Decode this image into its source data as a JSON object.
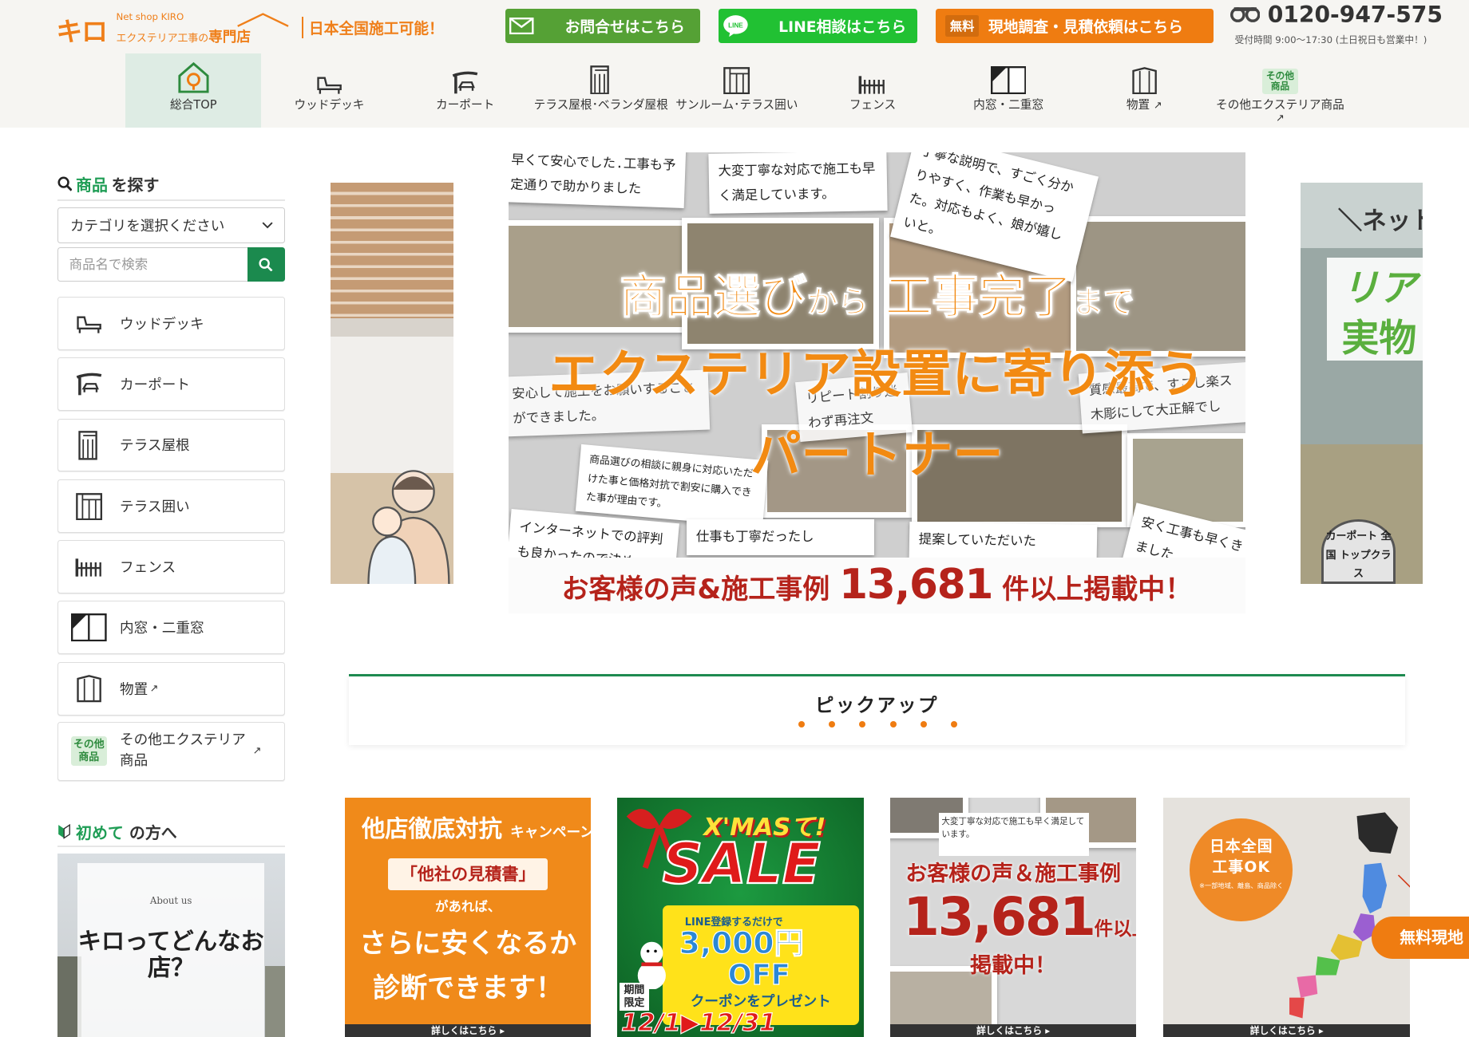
{
  "header": {
    "logo": {
      "brand": "キロ",
      "shop": "Net shop KIRO",
      "sub_small": "エクステリア工事の",
      "sub_big": "専門店",
      "nationwide": "日本全国施工可能！"
    },
    "contact_label": "お問合せはこちら",
    "line_label": "LINE相談はこちら",
    "line_icon_text": "LINE",
    "free_badge": "無料",
    "survey_label": "現地調査・見積依頼はこちら",
    "phone": "0120-947-575",
    "hours": "受付時間 9:00〜17:30 (土日祝日も営業中！)"
  },
  "nav": {
    "items": [
      {
        "label": "総合TOP",
        "icon": "home-icon"
      },
      {
        "label": "ウッドデッキ",
        "icon": "wood-deck-icon"
      },
      {
        "label": "カーポート",
        "icon": "carport-icon"
      },
      {
        "label": "テラス屋根･ベランダ屋根",
        "icon": "terrace-roof-icon"
      },
      {
        "label": "サンルーム･テラス囲い",
        "icon": "sunroom-icon"
      },
      {
        "label": "フェンス",
        "icon": "fence-icon"
      },
      {
        "label": "内窓・二重窓",
        "icon": "window-icon"
      },
      {
        "label": "物置",
        "icon": "storage-icon"
      },
      {
        "label": "その他エクステリア商品",
        "icon": "other-icon",
        "badge": "その他商品"
      }
    ]
  },
  "sidebar": {
    "search_title_green": "商品",
    "search_title_rest": "を探す",
    "category_select": "カテゴリを選択ください",
    "search_placeholder": "商品名で検索",
    "categories": [
      {
        "label": "ウッドデッキ",
        "icon": "wood-deck-icon"
      },
      {
        "label": "カーポート",
        "icon": "carport-icon"
      },
      {
        "label": "テラス屋根",
        "icon": "terrace-roof-icon"
      },
      {
        "label": "テラス囲い",
        "icon": "sunroom-icon"
      },
      {
        "label": "フェンス",
        "icon": "fence-icon"
      },
      {
        "label": "内窓・二重窓",
        "icon": "window-icon"
      },
      {
        "label": "物置",
        "icon": "storage-icon"
      },
      {
        "label": "その他エクステリア商品",
        "icon": "other-icon",
        "badge": "その他商品"
      }
    ],
    "first_green": "初めて",
    "first_rest": "の方へ",
    "about_en": "About us",
    "about_title": "キロってどんなお店？"
  },
  "hero": {
    "reviews": [
      "早くて安心でした.工事も予定通りで助かりました",
      "大変丁寧な対応で施工も早く満足しています。",
      "丁寧な説明で、すごく分かりやすく、作業も早かった。対応もよく、娘が嬉しいと。",
      "安心して施工をお願いすることができました。",
      "リピート割り迷わず再注文",
      "質感最高で、すこし楽ス木彫にして大正解でし",
      "商品選びの相談に親身に対応いただけた事と価格対抗で割安に購入できた事が理由です。",
      "インターネットでの評判も良かったので決め",
      "仕事も丁寧だったし",
      "提案していただいた",
      "安く工事も早くきました"
    ],
    "line1_a": "商品選び",
    "line1_b": "から",
    "line1_c": "工事完了",
    "line1_d": "まで",
    "line2": "エクステリア設置に寄り添う",
    "line3": "パートナー",
    "footer_a": "お客様の声&施工事例",
    "footer_num": "13,681",
    "footer_b": "件以上掲載中！",
    "right_peek_top": "＼ネット",
    "right_peek_mid1": "リア",
    "right_peek_mid2": "実物",
    "right_badge": "カーポート 全国 トップクラス"
  },
  "pickup": {
    "title": "ピックアップ",
    "dots": 6
  },
  "cards": {
    "more_label": "詳しくはこちら ▸",
    "c1": {
      "title": "他店徹底対抗",
      "title_small": "キャンペーン",
      "quote": "「他社の見積書」",
      "line": "があれば、",
      "big1": "さらに安くなるか",
      "big2": "診断できます！"
    },
    "c2": {
      "xmas": "X'MASて!",
      "sale": "SALE",
      "line_note": "LINE登録するだけで",
      "amount": "3,000円",
      "off": "OFF",
      "present": "クーポンをプレゼント",
      "limit": "期間限定",
      "dates": "12/1▶12/31"
    },
    "c3": {
      "paper": "大変丁寧な対応で施工も早く満足しています。",
      "title": "お客様の声＆施工事例",
      "num": "13,681",
      "num_suffix": "件以上",
      "tail": "掲載中！"
    },
    "c4": {
      "circle1": "日本全国",
      "circle2": "工事OK",
      "note": "※一部地域、離島、商品除く",
      "more": "＼ さらに"
    }
  },
  "floating_button": "無料現地"
}
